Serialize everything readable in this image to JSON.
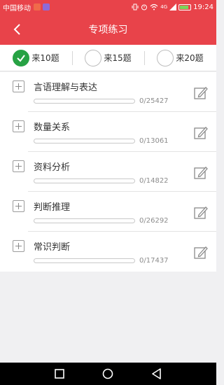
{
  "status_bar": {
    "carrier": "中国移动",
    "network": "4G",
    "time": "19:24",
    "icons": [
      "notification-red-icon",
      "notification-purple-icon",
      "vibrate-icon",
      "alarm-icon",
      "wifi-icon",
      "signal-icon",
      "battery-icon"
    ]
  },
  "header": {
    "title": "专项练习",
    "back_icon": "back-arrow-icon",
    "color": "#e8434a"
  },
  "options": [
    {
      "label": "来10题",
      "selected": true
    },
    {
      "label": "来15题",
      "selected": false
    },
    {
      "label": "来20题",
      "selected": false
    }
  ],
  "categories": [
    {
      "title": "言语理解与表达",
      "count": "0/25427",
      "progress": 0
    },
    {
      "title": "数量关系",
      "count": "0/13061",
      "progress": 0
    },
    {
      "title": "资料分析",
      "count": "0/14822",
      "progress": 0
    },
    {
      "title": "判断推理",
      "count": "0/26292",
      "progress": 0
    },
    {
      "title": "常识判断",
      "count": "0/17437",
      "progress": 0
    }
  ],
  "colors": {
    "accent": "#e8434a",
    "check": "#27a244"
  },
  "nav_bar": {
    "buttons": [
      "recent-apps-icon",
      "home-icon",
      "back-icon"
    ]
  }
}
